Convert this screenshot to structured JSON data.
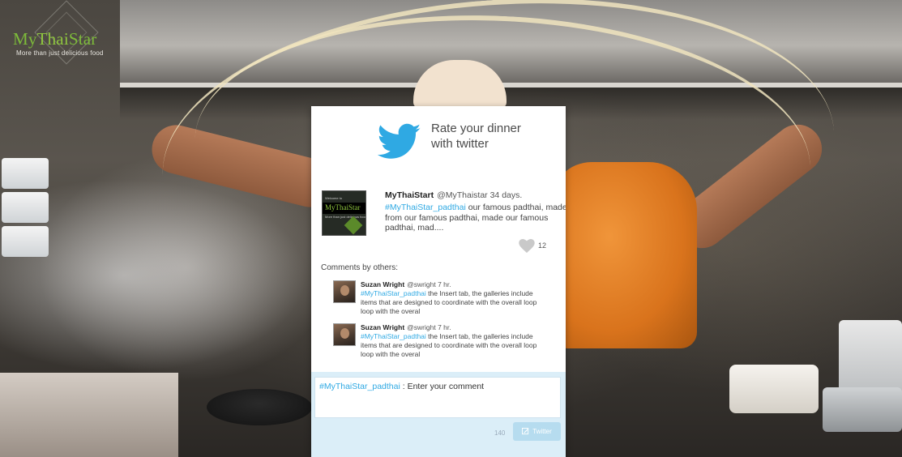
{
  "logo": {
    "title_part1": "My",
    "title_part2": "Thai",
    "title_part3": "Star",
    "tagline": "More than just delicious food"
  },
  "card": {
    "heading": "Rate your dinner with twitter"
  },
  "tweet": {
    "name": "MyThaiStart",
    "handle": "@MyThaistar 34 days.",
    "hashtag": "#MyThaiStar_padthai",
    "text": " our famous padthai, made from our famous padthai, made our famous padthai, mad....",
    "likes": "12",
    "avatar": {
      "welcome": "Welcome to",
      "title": "MyThaiStar",
      "tagline": "More than just delicious food"
    }
  },
  "comments_label": "Comments by others:",
  "comments": [
    {
      "name": "Suzan Wright",
      "handle": "@swright 7 hr.",
      "hashtag": "#MyThaiStar_padthai",
      "text": " the Insert tab, the galleries include items that are designed to coordinate with the overall loop loop  with the overal"
    },
    {
      "name": "Suzan Wright",
      "handle": "@swright 7 hr.",
      "hashtag": "#MyThaiStar_padthai",
      "text": " the Insert tab, the galleries include items that are designed to coordinate with the overall loop loop  with the overal"
    }
  ],
  "compose": {
    "hashtag": "#MyThaiStar_padthai",
    "placeholder": " : Enter your comment",
    "char_count": "140",
    "button_label": "Twitter"
  },
  "colors": {
    "twitter_blue": "#2fa9e3",
    "logo_green": "#8fc63f",
    "compose_bg": "#dbeef8",
    "button_bg": "#b6dcef"
  },
  "icons": {
    "bird": "twitter-bird-icon",
    "heart": "heart-icon",
    "pen": "pen-icon"
  }
}
